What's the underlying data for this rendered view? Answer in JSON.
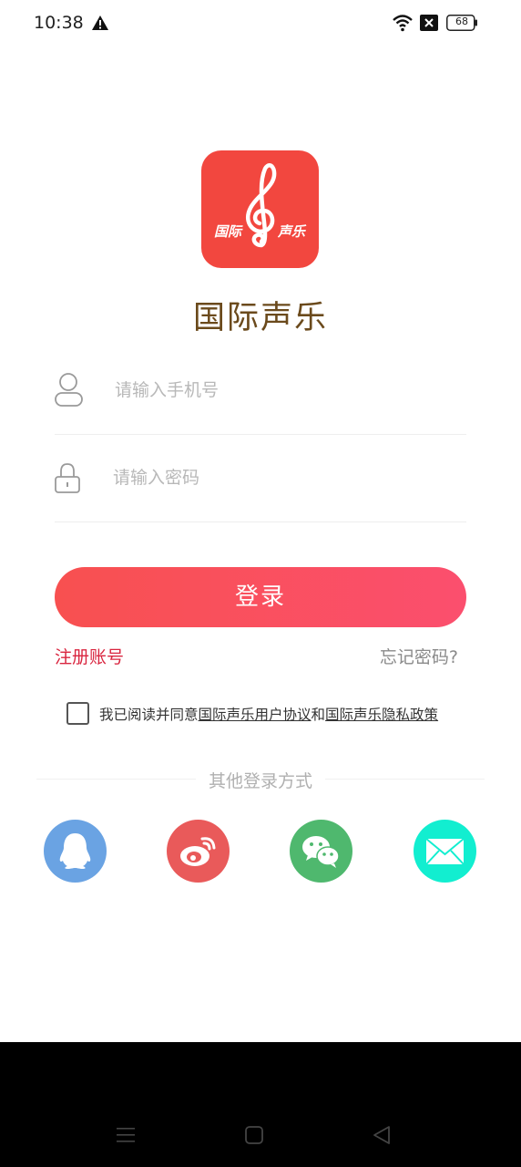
{
  "status_bar": {
    "time": "10:38",
    "battery": "68",
    "icons": [
      "warning-icon",
      "wifi-icon",
      "no-sim-icon",
      "battery-icon"
    ]
  },
  "app": {
    "name": "国际声乐",
    "logo_text_left": "国际",
    "logo_text_right": "声乐",
    "brand_color": "#f2473f"
  },
  "form": {
    "phone_placeholder": "请输入手机号",
    "phone_value": "",
    "password_placeholder": "请输入密码",
    "password_value": ""
  },
  "actions": {
    "login_label": "登录",
    "register_label": "注册账号",
    "forgot_label": "忘记密码?"
  },
  "agreement": {
    "checked": false,
    "prefix": "我已阅读并同意",
    "user_agreement": "国际声乐用户协议",
    "conjunction": "和",
    "privacy_policy": "国际声乐隐私政策"
  },
  "other_login": {
    "title": "其他登录方式",
    "providers": [
      {
        "name": "qq",
        "icon": "qq-icon",
        "color": "#6aa3e3"
      },
      {
        "name": "weibo",
        "icon": "weibo-icon",
        "color": "#e95a5a"
      },
      {
        "name": "wechat",
        "icon": "wechat-icon",
        "color": "#4fb86e"
      },
      {
        "name": "email",
        "icon": "mail-icon",
        "color": "#12eed0"
      }
    ]
  },
  "navigation": {
    "buttons": [
      "menu-icon",
      "home-icon",
      "back-icon"
    ]
  }
}
